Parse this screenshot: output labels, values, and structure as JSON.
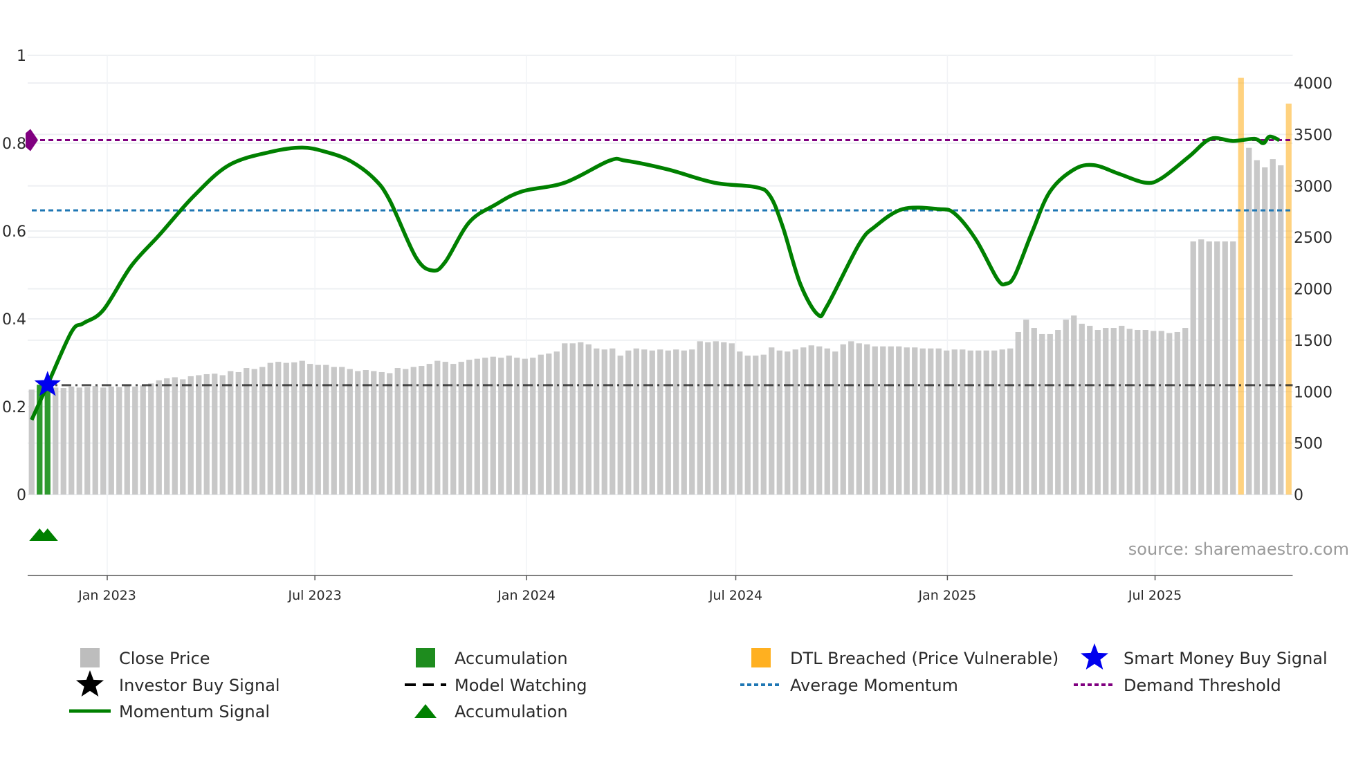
{
  "chart_data": {
    "type": "bar",
    "x_unit": "week index",
    "x_ticks": [
      {
        "index": 9.5,
        "label": "Jan 2023"
      },
      {
        "index": 35.6,
        "label": "Jul 2023"
      },
      {
        "index": 62.2,
        "label": "Jan 2024"
      },
      {
        "index": 88.5,
        "label": "Jul 2024"
      },
      {
        "index": 115.1,
        "label": "Jan 2025"
      },
      {
        "index": 141.2,
        "label": "Jul 2025"
      }
    ],
    "left_axis": {
      "ylim": [
        0,
        1
      ],
      "ticks": [
        "0",
        "0.2",
        "0.4",
        "0.6",
        "0.8",
        "1"
      ],
      "tick_values": [
        0,
        0.2,
        0.4,
        0.6,
        0.8,
        1
      ]
    },
    "right_axis": {
      "ylim": [
        0,
        4000
      ],
      "ticks": [
        "0",
        "500",
        "1000",
        "1500",
        "2000",
        "2500",
        "3000",
        "3500",
        "4000"
      ],
      "tick_values": [
        0,
        500,
        1000,
        1500,
        2000,
        2500,
        3000,
        3500,
        4000
      ]
    },
    "close_price": [
      1020,
      1030,
      1040,
      1040,
      1035,
      1050,
      1040,
      1045,
      1055,
      1040,
      1050,
      1045,
      1060,
      1050,
      1060,
      1080,
      1110,
      1130,
      1140,
      1120,
      1150,
      1160,
      1170,
      1175,
      1160,
      1200,
      1190,
      1230,
      1220,
      1240,
      1280,
      1290,
      1280,
      1285,
      1300,
      1270,
      1260,
      1260,
      1240,
      1240,
      1220,
      1200,
      1210,
      1200,
      1190,
      1180,
      1230,
      1220,
      1240,
      1250,
      1270,
      1300,
      1290,
      1270,
      1290,
      1310,
      1320,
      1330,
      1340,
      1330,
      1350,
      1330,
      1320,
      1330,
      1360,
      1370,
      1390,
      1470,
      1470,
      1480,
      1460,
      1420,
      1410,
      1420,
      1350,
      1400,
      1420,
      1410,
      1400,
      1410,
      1400,
      1410,
      1400,
      1410,
      1490,
      1480,
      1490,
      1480,
      1470,
      1390,
      1350,
      1350,
      1360,
      1430,
      1400,
      1390,
      1410,
      1430,
      1450,
      1440,
      1420,
      1390,
      1460,
      1490,
      1470,
      1460,
      1440,
      1440,
      1440,
      1440,
      1430,
      1430,
      1420,
      1420,
      1420,
      1400,
      1410,
      1410,
      1400,
      1400,
      1400,
      1400,
      1410,
      1420,
      1580,
      1700,
      1620,
      1560,
      1560,
      1600,
      1700,
      1740,
      1660,
      1640,
      1600,
      1620,
      1620,
      1640,
      1610,
      1600,
      1600,
      1590,
      1590,
      1570,
      1580,
      1620,
      2460,
      2480,
      2460,
      2460,
      2460,
      2460,
      null,
      3370,
      3250,
      3180,
      3260,
      3200,
      null
    ],
    "accumulation_bars": [
      {
        "index": 1,
        "value": 0.25
      },
      {
        "index": 2,
        "value": 0.25
      }
    ],
    "dtl_breached": [
      {
        "index": 152,
        "value": 4050
      },
      {
        "index": 158,
        "value": 3800
      }
    ],
    "momentum": [
      [
        0,
        0.17
      ],
      [
        2,
        0.25
      ],
      [
        5,
        0.37
      ],
      [
        6.5,
        0.39
      ],
      [
        9,
        0.42
      ],
      [
        12.5,
        0.52
      ],
      [
        16,
        0.59
      ],
      [
        20.4,
        0.68
      ],
      [
        24.8,
        0.75
      ],
      [
        30,
        0.78
      ],
      [
        34,
        0.79
      ],
      [
        37,
        0.78
      ],
      [
        40,
        0.76
      ],
      [
        43,
        0.72
      ],
      [
        45,
        0.67
      ],
      [
        48.3,
        0.54
      ],
      [
        50.4,
        0.51
      ],
      [
        52,
        0.53
      ],
      [
        55,
        0.62
      ],
      [
        58.3,
        0.66
      ],
      [
        61.6,
        0.69
      ],
      [
        67,
        0.71
      ],
      [
        72.6,
        0.76
      ],
      [
        74.7,
        0.76
      ],
      [
        80,
        0.74
      ],
      [
        85.8,
        0.71
      ],
      [
        91,
        0.7
      ],
      [
        92.8,
        0.68
      ],
      [
        94.4,
        0.61
      ],
      [
        96.6,
        0.48
      ],
      [
        98.8,
        0.41
      ],
      [
        100,
        0.43
      ],
      [
        104,
        0.57
      ],
      [
        106,
        0.61
      ],
      [
        109.5,
        0.65
      ],
      [
        114,
        0.65
      ],
      [
        116,
        0.64
      ],
      [
        118.7,
        0.58
      ],
      [
        121.4,
        0.49
      ],
      [
        122.5,
        0.48
      ],
      [
        123.6,
        0.5
      ],
      [
        125.8,
        0.6
      ],
      [
        128,
        0.69
      ],
      [
        131,
        0.74
      ],
      [
        133.5,
        0.75
      ],
      [
        136.7,
        0.73
      ],
      [
        140,
        0.71
      ],
      [
        142,
        0.72
      ],
      [
        145.5,
        0.77
      ],
      [
        148.2,
        0.81
      ],
      [
        151,
        0.805
      ],
      [
        153.7,
        0.81
      ],
      [
        154.8,
        0.8
      ],
      [
        155.6,
        0.815
      ],
      [
        156.8,
        0.807
      ]
    ],
    "demand_threshold": 0.807,
    "average_momentum": 0.647,
    "model_watching": 0.249,
    "smart_money_buy_signal": [
      {
        "index": 2,
        "value": 0.25
      }
    ],
    "accumulation_markers": [
      {
        "index": 1
      },
      {
        "index": 2
      }
    ],
    "legend": [
      {
        "label": "Close Price",
        "color": "#bdbdbd",
        "symbol": "square"
      },
      {
        "label": "Accumulation",
        "color": "#1e8c1e",
        "symbol": "square"
      },
      {
        "label": "DTL Breached (Price Vulnerable)",
        "color": "#ffb020",
        "symbol": "square"
      },
      {
        "label": "Smart Money Buy Signal",
        "color": "#0000ee",
        "symbol": "star"
      },
      {
        "label": "Investor Buy Signal",
        "color": "#000000",
        "symbol": "star"
      },
      {
        "label": "Model Watching",
        "color": "#000000",
        "symbol": "dash"
      },
      {
        "label": "Average Momentum",
        "color": "#1f77b4",
        "symbol": "dot"
      },
      {
        "label": "Demand Threshold",
        "color": "#800080",
        "symbol": "dot"
      },
      {
        "label": "Momentum Signal",
        "color": "#008000",
        "symbol": "line"
      },
      {
        "label": "Accumulation",
        "color": "#008000",
        "symbol": "triangle"
      }
    ],
    "legend_placement": "bottom",
    "grid": true
  },
  "source": "source: sharemaestro.com"
}
